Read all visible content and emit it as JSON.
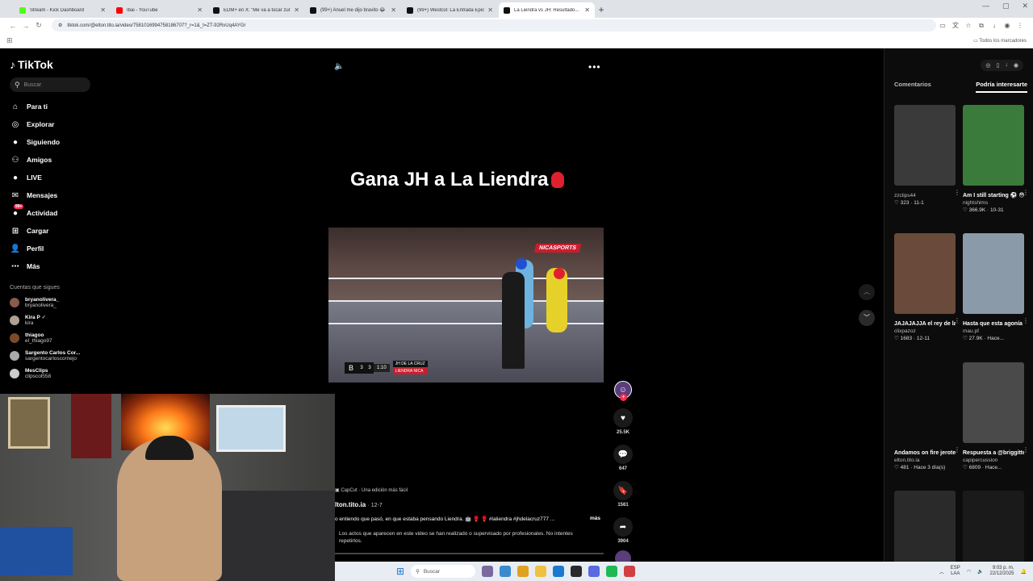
{
  "browser": {
    "tabs": [
      {
        "title": "Stream - Kick Dashboard",
        "color": "#53fc18"
      },
      {
        "title": "Ibai - YouTube",
        "color": "#ff0000"
      },
      {
        "title": "EDM+ en X: \"Me va a tocar zur...",
        "color": "#111111"
      },
      {
        "title": "(99+) Anuel me dijo bravito 😂",
        "color": "#111111"
      },
      {
        "title": "(99+) Westcol: La Entrada Épica...",
        "color": "#111111"
      },
      {
        "title": "La Liendra vs JH: Resultado...",
        "color": "#111111",
        "active": true
      }
    ],
    "url": "tiktok.com/@elton.tito.ia/video/7581016994758186707?_r=1&_t=ZT-92RvUq4AYGr",
    "bookmarks_label": "Todos los marcadores"
  },
  "sidebar": {
    "logo": "TikTok",
    "search_placeholder": "Buscar",
    "nav": [
      {
        "label": "Para ti",
        "icon": "home-icon",
        "glyph": "⌂"
      },
      {
        "label": "Explorar",
        "icon": "compass-icon",
        "glyph": "◎"
      },
      {
        "label": "Siguiendo",
        "icon": "avatar-icon",
        "glyph": "●"
      },
      {
        "label": "Amigos",
        "icon": "friends-icon",
        "glyph": "⚇"
      },
      {
        "label": "LIVE",
        "icon": "live-icon",
        "glyph": "●"
      },
      {
        "label": "Mensajes",
        "icon": "message-icon",
        "glyph": "✉"
      },
      {
        "label": "Actividad",
        "icon": "activity-icon",
        "glyph": "●",
        "badge": "99+"
      },
      {
        "label": "Cargar",
        "icon": "upload-icon",
        "glyph": "⊞"
      },
      {
        "label": "Perfil",
        "icon": "profile-icon",
        "glyph": "👤"
      },
      {
        "label": "Más",
        "icon": "more-icon",
        "glyph": "⋯"
      }
    ],
    "following_header": "Cuentas que sigues",
    "following": [
      {
        "name": "bryanolivera_",
        "handle": "bryanolivera_",
        "color": "#8a5a4a"
      },
      {
        "name": "Kira P ✓",
        "handle": "kira",
        "color": "#b0a090"
      },
      {
        "name": "thiagoo",
        "handle": "el_thiago97",
        "color": "#7a4a2a"
      },
      {
        "name": "Sargento Carlos Cor...",
        "handle": "sargentocarloscornejo",
        "color": "#aaaaaa"
      },
      {
        "name": "MesClips",
        "handle": "clipscol558",
        "color": "#cccccc"
      }
    ]
  },
  "video": {
    "headline": "Gana JH a La Liendra",
    "broadcast_logo": "NICASPORTS",
    "score_left": "3",
    "score_right": "3",
    "clock": "1:10",
    "fighter_1": "JH DE LA CRUZ",
    "fighter_2": "LIENDRA NICA"
  },
  "actions": {
    "likes": "25.5K",
    "comments": "647",
    "saves": "1561",
    "shares": "3904"
  },
  "caption": {
    "capcut": "CapCut · Una edición más fácil",
    "author": "lton.tito.ia",
    "date": "· 12-7",
    "description": "o entiendo que pasó, en que estaba pensando Liendra. 🤖 🥊 🥊 #laliendra #jhdelacruz777 ...",
    "more": "más",
    "disclaimer": "Los actos que aparecen en este video se han realizado o supervisado por profesionales. No intentes repetirlos."
  },
  "right_panel": {
    "tabs": [
      "Comentarios",
      "Podría interesarte"
    ],
    "active_tab": "Podría interesarte",
    "cards": [
      {
        "caption": "",
        "user": "zzclips44",
        "meta": "♡ 323 · 11-1",
        "thumb": "#3a3a3a"
      },
      {
        "caption": "Am I still starting ⚽️ 😳 #nightshi...",
        "user": "nightshims",
        "meta": "♡ 366.9K · 10-31",
        "thumb": "#3a7a3a"
      },
      {
        "caption": "JAJAJAJJA el rey de la tinta...",
        "user": "clixpazoz",
        "meta": "♡ 1683 · 12-11",
        "thumb": "#6a4a3a"
      },
      {
        "caption": "Hasta que esta agonía se le olvi...",
        "user": "mau.pf",
        "meta": "♡ 27.9K · Hace...",
        "thumb": "#8a9aa8"
      },
      {
        "caption": "Andamos on fire jerote jerota 😂 ...",
        "user": "elton.tito.ia",
        "meta": "♡ 481 · Hace 3 día(s)",
        "thumb": "#0c0c0c"
      },
      {
        "caption": "Respuesta a @briggitte.bazur...",
        "user": "capipercussion",
        "meta": "♡ 6809 · Hace...",
        "thumb": "#4a4a4a"
      },
      {
        "caption": "",
        "user": "",
        "meta": "",
        "thumb": "#2a2a2a"
      },
      {
        "caption": "",
        "user": "",
        "meta": "",
        "thumb": "#1a1a1a"
      }
    ]
  },
  "taskbar": {
    "search_placeholder": "Buscar",
    "lang": "ESP",
    "lang2": "LAA",
    "time": "9:03 p. m.",
    "date": "22/12/2025"
  }
}
